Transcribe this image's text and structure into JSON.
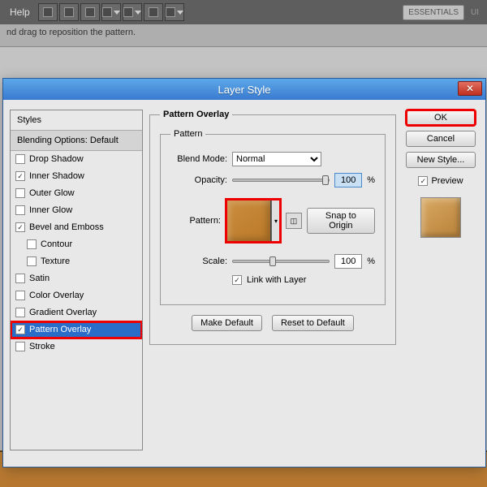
{
  "top_toolbar": {
    "menu": "Help",
    "workspace_btn": "ESSENTIALS",
    "tab_right": "UI"
  },
  "options_bar": {
    "hint": "nd drag to reposition the pattern."
  },
  "dialog": {
    "title": "Layer Style",
    "styles_header": "Styles",
    "blend_header": "Blending Options: Default",
    "effects": [
      {
        "label": "Drop Shadow",
        "on": false
      },
      {
        "label": "Inner Shadow",
        "on": true
      },
      {
        "label": "Outer Glow",
        "on": false
      },
      {
        "label": "Inner Glow",
        "on": false
      },
      {
        "label": "Bevel and Emboss",
        "on": true
      },
      {
        "label": "Contour",
        "on": false,
        "sub": true
      },
      {
        "label": "Texture",
        "on": false,
        "sub": true
      },
      {
        "label": "Satin",
        "on": false
      },
      {
        "label": "Color Overlay",
        "on": false
      },
      {
        "label": "Gradient Overlay",
        "on": false
      },
      {
        "label": "Pattern Overlay",
        "on": true,
        "selected": true,
        "hl": true
      },
      {
        "label": "Stroke",
        "on": false
      }
    ],
    "panel": {
      "group": "Pattern Overlay",
      "subgroup": "Pattern",
      "blend_mode_label": "Blend Mode:",
      "blend_mode": "Normal",
      "opacity_label": "Opacity:",
      "opacity": "100",
      "pct": "%",
      "pattern_label": "Pattern:",
      "snap": "Snap to Origin",
      "scale_label": "Scale:",
      "scale": "100",
      "link_label": "Link with Layer",
      "link_on": true,
      "make_default": "Make Default",
      "reset_default": "Reset to Default"
    },
    "right": {
      "ok": "OK",
      "cancel": "Cancel",
      "new_style": "New Style...",
      "preview": "Preview",
      "preview_on": true
    }
  }
}
